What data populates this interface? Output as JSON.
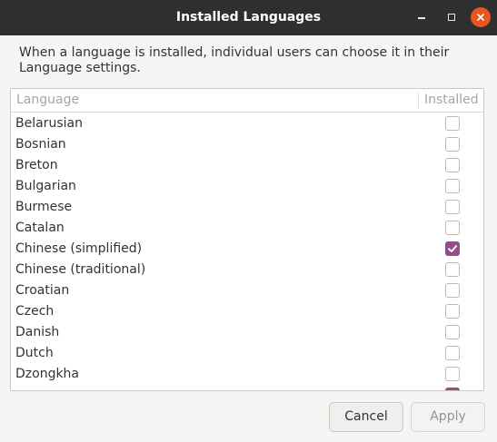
{
  "window": {
    "title": "Installed Languages"
  },
  "description": "When a language is installed, individual users can choose it in their Language settings.",
  "list": {
    "columns": {
      "language": "Language",
      "installed": "Installed"
    },
    "rows": [
      {
        "language": "Belarusian",
        "installed": false
      },
      {
        "language": "Bosnian",
        "installed": false
      },
      {
        "language": "Breton",
        "installed": false
      },
      {
        "language": "Bulgarian",
        "installed": false
      },
      {
        "language": "Burmese",
        "installed": false
      },
      {
        "language": "Catalan",
        "installed": false
      },
      {
        "language": "Chinese (simplified)",
        "installed": true
      },
      {
        "language": "Chinese (traditional)",
        "installed": false
      },
      {
        "language": "Croatian",
        "installed": false
      },
      {
        "language": "Czech",
        "installed": false
      },
      {
        "language": "Danish",
        "installed": false
      },
      {
        "language": "Dutch",
        "installed": false
      },
      {
        "language": "Dzongkha",
        "installed": false
      },
      {
        "language": "",
        "installed": true
      }
    ]
  },
  "buttons": {
    "cancel": "Cancel",
    "apply": "Apply"
  },
  "colors": {
    "titlebar": "#2f2f2f",
    "close_button": "#e95420",
    "checkbox_checked": "#924d8b"
  }
}
